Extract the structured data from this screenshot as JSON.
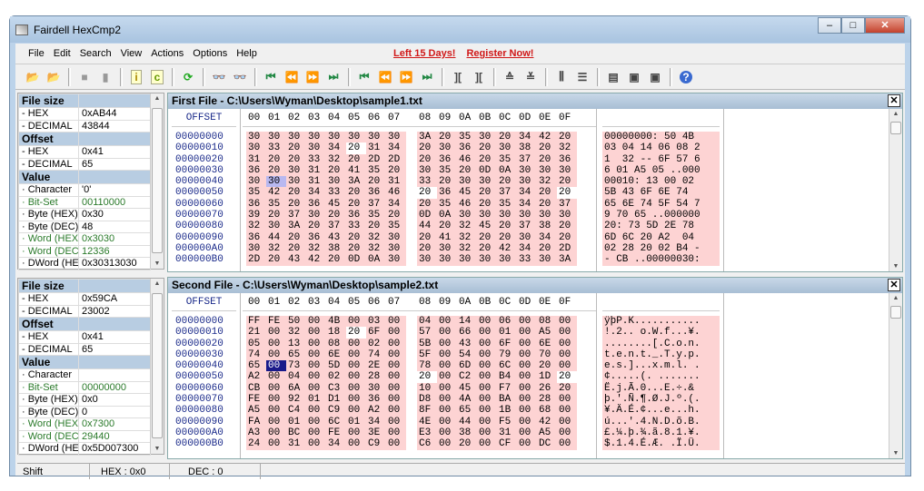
{
  "window": {
    "title": "Fairdell HexCmp2",
    "controls": [
      "minimize",
      "maximize",
      "close"
    ]
  },
  "menu": [
    "File",
    "Edit",
    "Search",
    "View",
    "Actions",
    "Options",
    "Help"
  ],
  "promo": {
    "days": "Left 15 Days!",
    "register": "Register Now!",
    "color": "#d01818"
  },
  "toolbar": [
    "open-file1-icon",
    "open-file2-icon",
    "sep",
    "stop-icon",
    "copy-icon",
    "sep",
    "info-icon",
    "compare-icon",
    "sep",
    "refresh-icon",
    "sep",
    "find-icon",
    "find-next-icon",
    "sep",
    "first-diff-icon",
    "prev-diff-icon",
    "next-diff-icon",
    "last-diff-icon",
    "sep",
    "first-block-icon",
    "prev-block-icon",
    "next-block-icon",
    "last-block-icon",
    "sep",
    "sync-left-icon",
    "sync-right-icon",
    "sep",
    "align-up-icon",
    "align-down-icon",
    "sep",
    "columns-icon",
    "list-icon",
    "sep",
    "report-icon",
    "export-icon",
    "print-icon",
    "sep",
    "help-icon"
  ],
  "props": [
    {
      "rows": [
        [
          "File size",
          "",
          1
        ],
        [
          "- HEX",
          "0xAB44"
        ],
        [
          "- DECIMAL",
          "43844"
        ],
        [
          "Offset",
          "",
          1
        ],
        [
          "- HEX",
          "0x41"
        ],
        [
          "- DECIMAL",
          "65"
        ],
        [
          "Value",
          "",
          1
        ],
        [
          "· Character",
          "'0'"
        ],
        [
          "· Bit-Set",
          "00110000",
          2
        ],
        [
          "· Byte (HEX)",
          "0x30"
        ],
        [
          "· Byte (DEC)",
          "48"
        ],
        [
          "· Word (HEX)",
          "0x3030",
          2
        ],
        [
          "· Word (DEC)",
          "12336",
          2
        ],
        [
          "· DWord (HEX)",
          "0x30313030"
        ]
      ]
    },
    {
      "rows": [
        [
          "File size",
          "",
          1
        ],
        [
          "- HEX",
          "0x59CA"
        ],
        [
          "- DECIMAL",
          "23002"
        ],
        [
          "Offset",
          "",
          1
        ],
        [
          "- HEX",
          "0x41"
        ],
        [
          "- DECIMAL",
          "65"
        ],
        [
          "Value",
          "",
          1
        ],
        [
          "· Character",
          ""
        ],
        [
          "· Bit-Set",
          "00000000",
          2
        ],
        [
          "· Byte (HEX)",
          "0x0"
        ],
        [
          "· Byte (DEC)",
          "0"
        ],
        [
          "· Word (HEX)",
          "0x7300",
          2
        ],
        [
          "· Word (DEC)",
          "29440",
          2
        ],
        [
          "· DWord (HEX)",
          "0x5D007300"
        ]
      ]
    }
  ],
  "offset_header": "OFFSET",
  "col_headers": [
    "00",
    "01",
    "02",
    "03",
    "04",
    "05",
    "06",
    "07",
    "08",
    "09",
    "0A",
    "0B",
    "0C",
    "0D",
    "0E",
    "0F"
  ],
  "offsets": [
    "00000000",
    "00000010",
    "00000020",
    "00000030",
    "00000040",
    "00000050",
    "00000060",
    "00000070",
    "00000080",
    "00000090",
    "000000A0",
    "000000B0"
  ],
  "same_cells": [
    [
      1,
      5
    ],
    [
      5,
      8
    ],
    [
      5,
      15
    ]
  ],
  "cursor": [
    4,
    1
  ],
  "files": [
    {
      "title": "First File - C:\\Users\\Wyman\\Desktop\\sample1.txt",
      "hex": [
        "30 30 30 30 30 30 30 30 3A 20 35 30 20 34 42 20",
        "30 33 20 30 34 20 31 34 20 30 36 20 30 38 20 32",
        "31 20 20 33 32 20 2D 2D 20 36 46 20 35 37 20 36",
        "36 20 30 31 20 41 35 20 30 35 20 0D 0A 30 30 30",
        "30 30 30 31 30 3A 20 31 33 20 30 30 20 30 32 20",
        "35 42 20 34 33 20 36 46 20 36 45 20 37 34 20 20",
        "36 35 20 36 45 20 37 34 20 35 46 20 35 34 20 37",
        "39 20 37 30 20 36 35 20 0D 0A 30 30 30 30 30 30",
        "32 30 3A 20 37 33 20 35 44 20 32 45 20 37 38 20",
        "36 44 20 36 43 20 32 30 20 41 32 20 20 30 34 20",
        "30 32 20 32 38 20 32 30 20 30 32 20 42 34 20 2D",
        "2D 20 43 42 20 0D 0A 30 30 30 30 30 30 33 30 3A"
      ],
      "ascii": [
        "00000000: 50 4B ",
        "03 04 14 06 08 2",
        "1  32 -- 6F 57 6",
        "6 01 A5 05 ..000",
        "00010: 13 00 02 ",
        "5B 43 6F 6E 74  ",
        "65 6E 74 5F 54 7",
        "9 70 65 ..000000",
        "20: 73 5D 2E 78 ",
        "6D 6C 20 A2  04 ",
        "02 28 20 02 B4 -",
        "- CB ..00000030:"
      ]
    },
    {
      "title": "Second File - C:\\Users\\Wyman\\Desktop\\sample2.txt",
      "hex": [
        "FF FE 50 00 4B 00 03 00 04 00 14 00 06 00 08 00",
        "21 00 32 00 18 20 6F 00 57 00 66 00 01 00 A5 00",
        "05 00 13 00 08 00 02 00 5B 00 43 00 6F 00 6E 00",
        "74 00 65 00 6E 00 74 00 5F 00 54 00 79 00 70 00",
        "65 00 73 00 5D 00 2E 00 78 00 6D 00 6C 00 20 00",
        "A2 00 04 00 02 00 28 00 20 00 C2 00 B4 00 1D 20",
        "CB 00 6A 00 C3 00 30 00 10 00 45 00 F7 00 26 20",
        "FE 00 92 01 D1 00 36 00 D8 00 4A 00 BA 00 28 00",
        "A5 00 C4 00 C9 00 A2 00 8F 00 65 00 1B 00 68 00",
        "FA 00 01 00 6C 01 34 00 4E 00 44 00 F5 00 42 00",
        "A3 00 BC 00 FE 00 3E 00 E3 00 38 00 31 00 A5 00",
        "24 00 31 00 34 00 C9 00 C6 00 20 00 CF 00 DC 00"
      ],
      "ascii": [
        "ÿþP.K...........",
        "!.2.. o.W.f...¥.",
        "........[.C.o.n.",
        "t.e.n.t._.T.y.p.",
        "e.s.]...x.m.l. .",
        "¢.....(. ....... ",
        "Ë.j.Ã.0...E.÷.&",
        "þ.'.Ñ.¶.Ø.J.º.(.",
        "¥.Ä.É.¢...e...h.",
        "ú...'.4.N.D.õ.B.",
        "£.¼.þ.¾.ã.8.1.¥.",
        "$.1.4.É.Æ. .Ï.Ü."
      ]
    }
  ],
  "status": {
    "mode": "Shift",
    "hex": "HEX : 0x0",
    "dec": "DEC : 0"
  },
  "colors": {
    "diff": "#fdd3d3",
    "header": "#b8cde2"
  }
}
